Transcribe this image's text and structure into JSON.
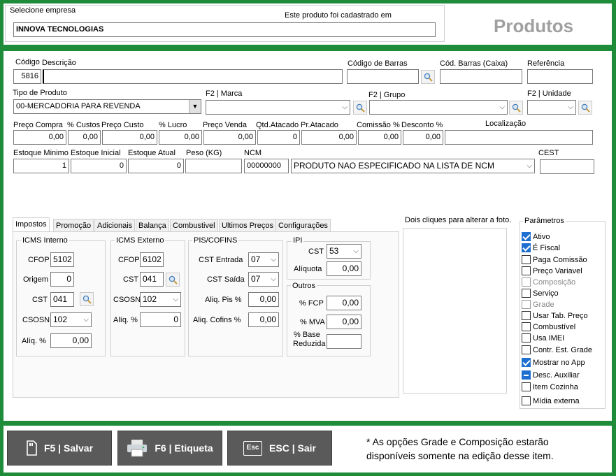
{
  "header": {
    "selecione_label": "Selecione empresa",
    "empresa_value": "INNOVA TECNOLOGIAS",
    "cadastrado_label": "Este produto foi cadastrado em",
    "title": "Produtos"
  },
  "form": {
    "codigo_label": "Código",
    "codigo_value": "5816",
    "descricao_label": "Descrição",
    "descricao_value": "",
    "codigo_barras_label": "Código de Barras",
    "cod_barras_caixa_label": "Cód. Barras (Caixa)",
    "referencia_label": "Referência",
    "tipo_produto_label": "Tipo de Produto",
    "tipo_produto_value": "00-MERCADORIA PARA REVENDA",
    "marca_label": "F2 | Marca",
    "grupo_label": "F2 | Grupo",
    "unidade_label": "F2 | Unidade",
    "preco_compra_label": "Preço Compra",
    "preco_compra_value": "0,00",
    "custos_label": "% Custos",
    "custos_value": "0,00",
    "preco_custo_label": "Preço Custo",
    "preco_custo_value": "0,00",
    "lucro_label": "% Lucro",
    "lucro_value": "0,00",
    "preco_venda_label": "Preço Venda",
    "preco_venda_value": "0,00",
    "qtd_atacado_label": "Qtd.Atacado",
    "qtd_atacado_value": "0",
    "pr_atacado_label": "Pr.Atacado",
    "pr_atacado_value": "0,00",
    "comissao_label": "Comissão %",
    "comissao_value": "0,00",
    "desconto_label": "Desconto %",
    "desconto_value": "0,00",
    "localizacao_label": "Localização",
    "estoque_minimo_label": "Estoque Minimo",
    "estoque_minimo_value": "1",
    "estoque_inicial_label": "Estoque Inicial",
    "estoque_inicial_value": "0",
    "estoque_atual_label": "Estoque Atual",
    "estoque_atual_value": "0",
    "peso_label": "Peso (KG)",
    "ncm_label": "NCM",
    "ncm_value": "00000000",
    "ncm_desc_value": "PRODUTO NAO ESPECIFICADO NA LISTA DE NCM",
    "cest_label": "CEST"
  },
  "tabs": [
    "Impostos",
    "Promoção",
    "Adicionais",
    "Balança",
    "Combustivel",
    "Ultimos Preços",
    "Configurações"
  ],
  "impostos": {
    "icms_interno": {
      "title": "ICMS Interno",
      "cfop_label": "CFOP",
      "cfop_value": "5102",
      "origem_label": "Origem",
      "origem_value": "0",
      "cst_label": "CST",
      "cst_value": "041",
      "csosn_label": "CSOSN",
      "csosn_value": "102",
      "aliq_label": "Alíq. %",
      "aliq_value": "0,00"
    },
    "icms_externo": {
      "title": "ICMS Externo",
      "cfop_label": "CFOP",
      "cfop_value": "6102",
      "cst_label": "CST",
      "cst_value": "041",
      "csosn_label": "CSOSN",
      "csosn_value": "102",
      "aliq_label": "Alíq. %",
      "aliq_value": "0"
    },
    "pis_cofins": {
      "title": "PIS/COFINS",
      "cst_entrada_label": "CST Entrada",
      "cst_entrada_value": "07",
      "cst_saida_label": "CST Saída",
      "cst_saida_value": "07",
      "aliq_pis_label": "Aliq. Pis %",
      "aliq_pis_value": "0,00",
      "aliq_cofins_label": "Aliq. Cofins %",
      "aliq_cofins_value": "0,00"
    },
    "ipi": {
      "title": "IPI",
      "cst_label": "CST",
      "cst_value": "53",
      "aliquota_label": "Alíquota",
      "aliquota_value": "0,00"
    },
    "outros": {
      "title": "Outros",
      "fcp_label": "% FCP",
      "fcp_value": "0,00",
      "mva_label": "% MVA",
      "mva_value": "0,00",
      "base_label_1": "% Base",
      "base_label_2": "Reduzida",
      "base_value": ""
    }
  },
  "foto": {
    "hint": "Dois cliques para alterar a foto."
  },
  "parametros": {
    "title": "Parâmetros",
    "items": [
      {
        "label": "Ativo",
        "state": "checked"
      },
      {
        "label": "É Fiscal",
        "state": "checked"
      },
      {
        "label": "Paga Comissão",
        "state": "unchecked"
      },
      {
        "label": "Preço Variavel",
        "state": "unchecked"
      },
      {
        "label": "Composição",
        "state": "disabled"
      },
      {
        "label": "Serviço",
        "state": "unchecked"
      },
      {
        "label": "Grade",
        "state": "disabled"
      },
      {
        "label": "Usar Tab. Preço",
        "state": "unchecked"
      },
      {
        "label": "Combustível",
        "state": "unchecked"
      },
      {
        "label": "Usa IMEI",
        "state": "unchecked"
      },
      {
        "label": "Contr. Est. Grade",
        "state": "unchecked"
      },
      {
        "label": "Mostrar no App",
        "state": "checked"
      },
      {
        "label": "Desc. Auxiliar",
        "state": "indeterminate"
      },
      {
        "label": "Item Cozinha",
        "state": "unchecked"
      },
      {
        "label": "Mídia externa",
        "state": "unchecked"
      }
    ]
  },
  "footer": {
    "salvar_label": "F5 | Salvar",
    "etiqueta_label": "F6 | Etiqueta",
    "sair_label": "ESC | Sair",
    "esc_key": "Esc",
    "note_line1": "* As opções Grade e Composição estarão",
    "note_line2": "disponíveis somente na edição desse item."
  },
  "colors": {
    "frame_green": "#1e8c38",
    "button_gray": "#5a5a5a",
    "check_blue": "#1f6fd0",
    "title_gray": "#a0a0a0"
  }
}
